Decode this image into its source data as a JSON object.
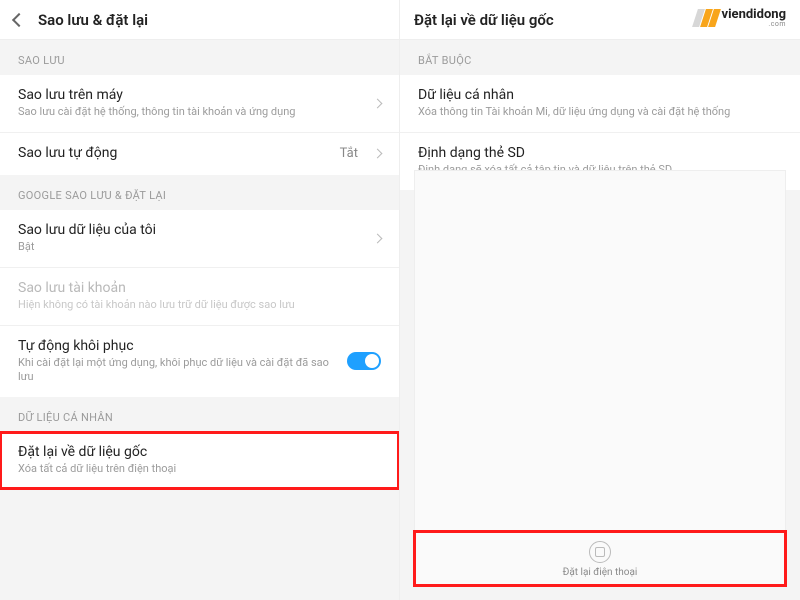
{
  "watermark": {
    "brand": "viendidong",
    "tld": ".com"
  },
  "left": {
    "title": "Sao lưu & đặt lại",
    "sections": {
      "backup": {
        "label": "SAO LƯU",
        "local": {
          "title": "Sao lưu trên máy",
          "sub": "Sao lưu cài đặt hệ thống, thông tin tài khoản và ứng dụng"
        },
        "auto": {
          "title": "Sao lưu tự động",
          "value": "Tắt"
        }
      },
      "google": {
        "label": "GOOGLE SAO LƯU & ĐẶT LẠI",
        "myData": {
          "title": "Sao lưu dữ liệu của tôi",
          "sub": "Bật"
        },
        "account": {
          "title": "Sao lưu tài khoản",
          "sub": "Hiện không có tài khoản nào lưu trữ dữ liệu được sao lưu"
        },
        "autoRestore": {
          "title": "Tự động khôi phục",
          "sub": "Khi cài đặt lại một ứng dụng, khôi phục dữ liệu và cài đặt đã sao lưu"
        }
      },
      "personal": {
        "label": "DỮ LIỆU CÁ NHÂN",
        "factory": {
          "title": "Đặt lại về dữ liệu gốc",
          "sub": "Xóa tất cả dữ liệu trên điện thoại"
        }
      }
    }
  },
  "right": {
    "title": "Đặt lại về dữ liệu gốc",
    "section": {
      "label": "BẮT BUỘC",
      "personalData": {
        "title": "Dữ liệu cá nhân",
        "sub": "Xóa thông tin Tài khoản Mi, dữ liệu ứng dụng và cài đặt hệ thống"
      },
      "sdFormat": {
        "title": "Định dạng thẻ SD",
        "sub": "Định dạng sẽ xóa tất cả tập tin và dữ liệu trên thẻ SD"
      }
    },
    "bottomButton": {
      "label": "Đặt lại điện thoại"
    }
  }
}
